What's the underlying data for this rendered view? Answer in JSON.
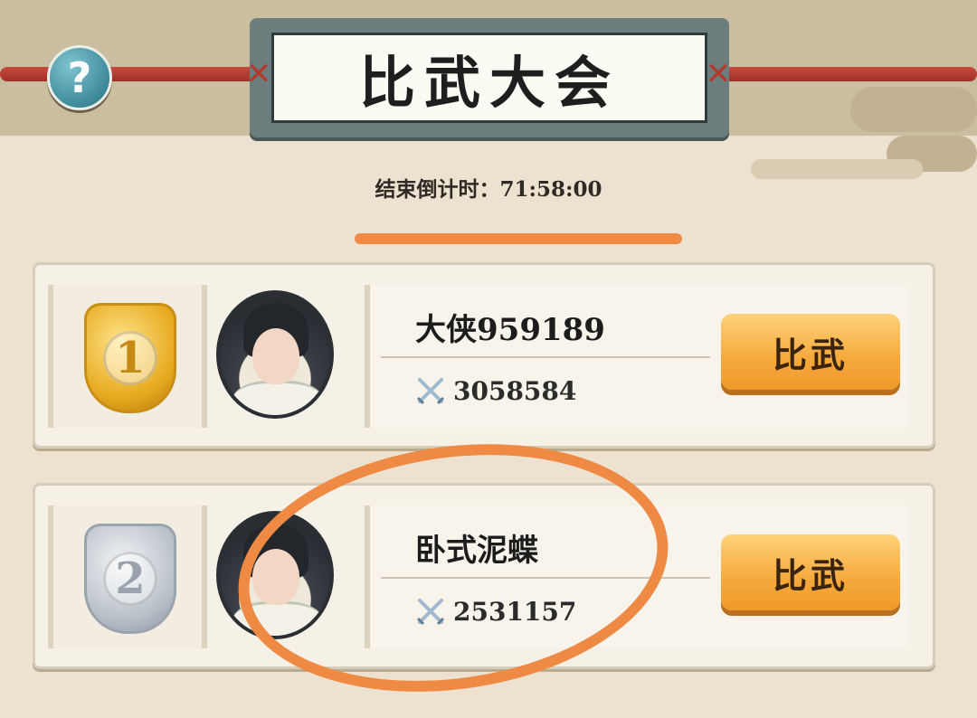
{
  "header": {
    "title": "比武大会",
    "help_icon": "question-icon",
    "help_symbol": "?"
  },
  "countdown": {
    "label": "结束倒计时：",
    "value": "71:58:00"
  },
  "players": [
    {
      "rank": "1",
      "medal": "gold-medal-icon",
      "name": "大侠959189",
      "power_icon": "crossed-swords-icon",
      "power": "3058584",
      "action_label": "比武"
    },
    {
      "rank": "2",
      "medal": "silver-medal-icon",
      "name": "卧式泥蝶",
      "power_icon": "crossed-swords-icon",
      "power": "2531157",
      "action_label": "比武"
    }
  ],
  "colors": {
    "accent_orange": "#ef8a45",
    "button_orange": "#f5a93b",
    "rope_red": "#c94a3f",
    "plaque_teal": "#6b7d7c"
  }
}
